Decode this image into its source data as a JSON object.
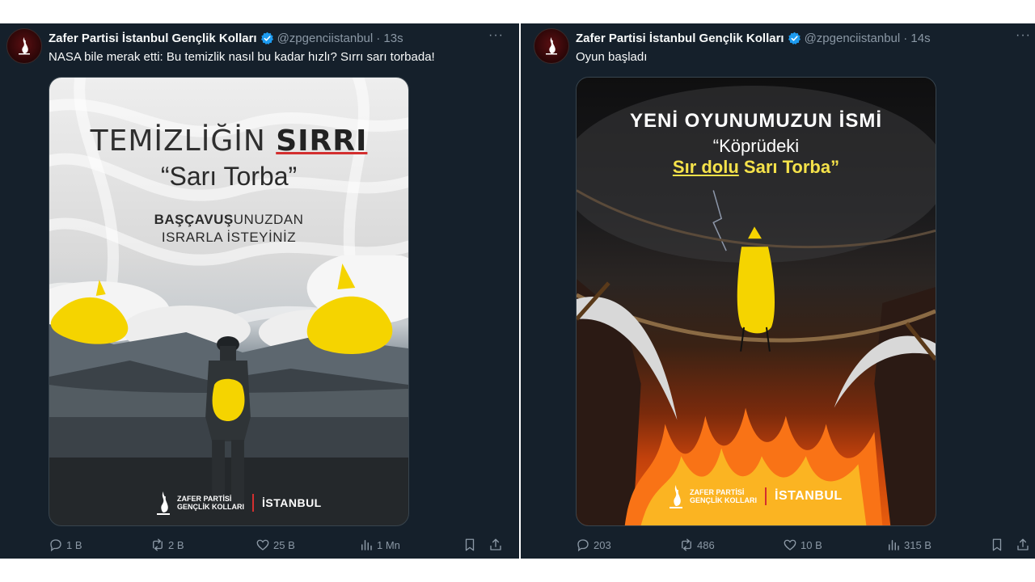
{
  "tweets": [
    {
      "author": "Zafer Partisi İstanbul Gençlik Kolları",
      "handle": "@zpgenciistanbul",
      "time": "· 13s",
      "text": "NASA bile merak etti: Bu temizlik nasıl bu kadar hızlı? Sırrı sarı torbada!",
      "poster": {
        "title_prefix": "TEMİZLİĞİN ",
        "title_bold": "SIRRI",
        "subtitle": "“Sarı Torba”",
        "slogan_bold": "BAŞÇAVUŞ",
        "slogan_rest": "UNUZDAN",
        "slogan_line2": "ISRARLA İSTEYİNİZ",
        "logo_line1": "ZAFER PARTİSİ",
        "logo_line2": "GENÇLİK KOLLARI",
        "logo_city": "İSTANBUL"
      },
      "stats": {
        "replies": "1 B",
        "retweets": "2 B",
        "likes": "25 B",
        "views": "1 Mn"
      }
    },
    {
      "author": "Zafer Partisi İstanbul Gençlik Kolları",
      "handle": "@zpgenciistanbul",
      "time": "· 14s",
      "text": "Oyun başladı",
      "poster": {
        "line1": "YENİ OYUNUMUZUN İSMİ",
        "line2": "“Köprüdeki",
        "line3_underlined": "Sır dolu",
        "line3_rest": " Sarı Torba”",
        "logo_line1": "ZAFER PARTİSİ",
        "logo_line2": "GENÇLİK KOLLARI",
        "logo_city": "İSTANBUL"
      },
      "stats": {
        "replies": "203",
        "retweets": "486",
        "likes": "10 B",
        "views": "315 B"
      }
    }
  ],
  "more_label": "···",
  "colors": {
    "background": "#15202b",
    "text": "#f7f9f9",
    "muted": "#8b98a5",
    "verified": "#1d9bf0",
    "bag_yellow": "#f5d400"
  },
  "icons": [
    "reply-icon",
    "retweet-icon",
    "like-icon",
    "views-icon",
    "bookmark-icon",
    "share-icon",
    "verified-icon"
  ]
}
